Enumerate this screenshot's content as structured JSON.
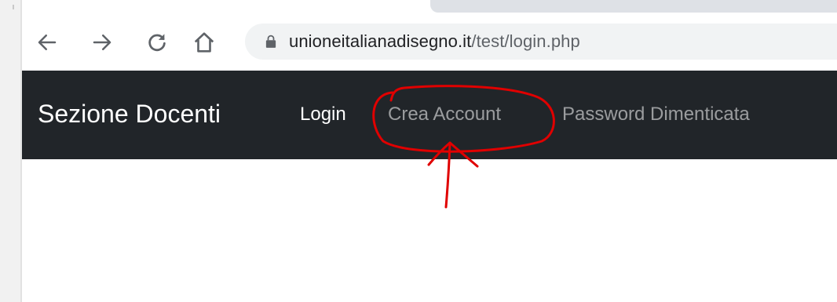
{
  "browser": {
    "url_domain": "unioneitalianadisegno.it",
    "url_path": "/test/login.php",
    "icons": {
      "back": "arrow-left-icon",
      "forward": "arrow-right-icon",
      "reload": "reload-icon",
      "home": "home-icon",
      "lock": "lock-icon"
    }
  },
  "navbar": {
    "brand": "Sezione Docenti",
    "links": [
      {
        "label": "Login",
        "active": true
      },
      {
        "label": "Crea Account",
        "active": false
      },
      {
        "label": "Password Dimenticata",
        "active": false
      }
    ],
    "background_color": "#212529"
  },
  "annotation": {
    "color": "#e00000"
  }
}
